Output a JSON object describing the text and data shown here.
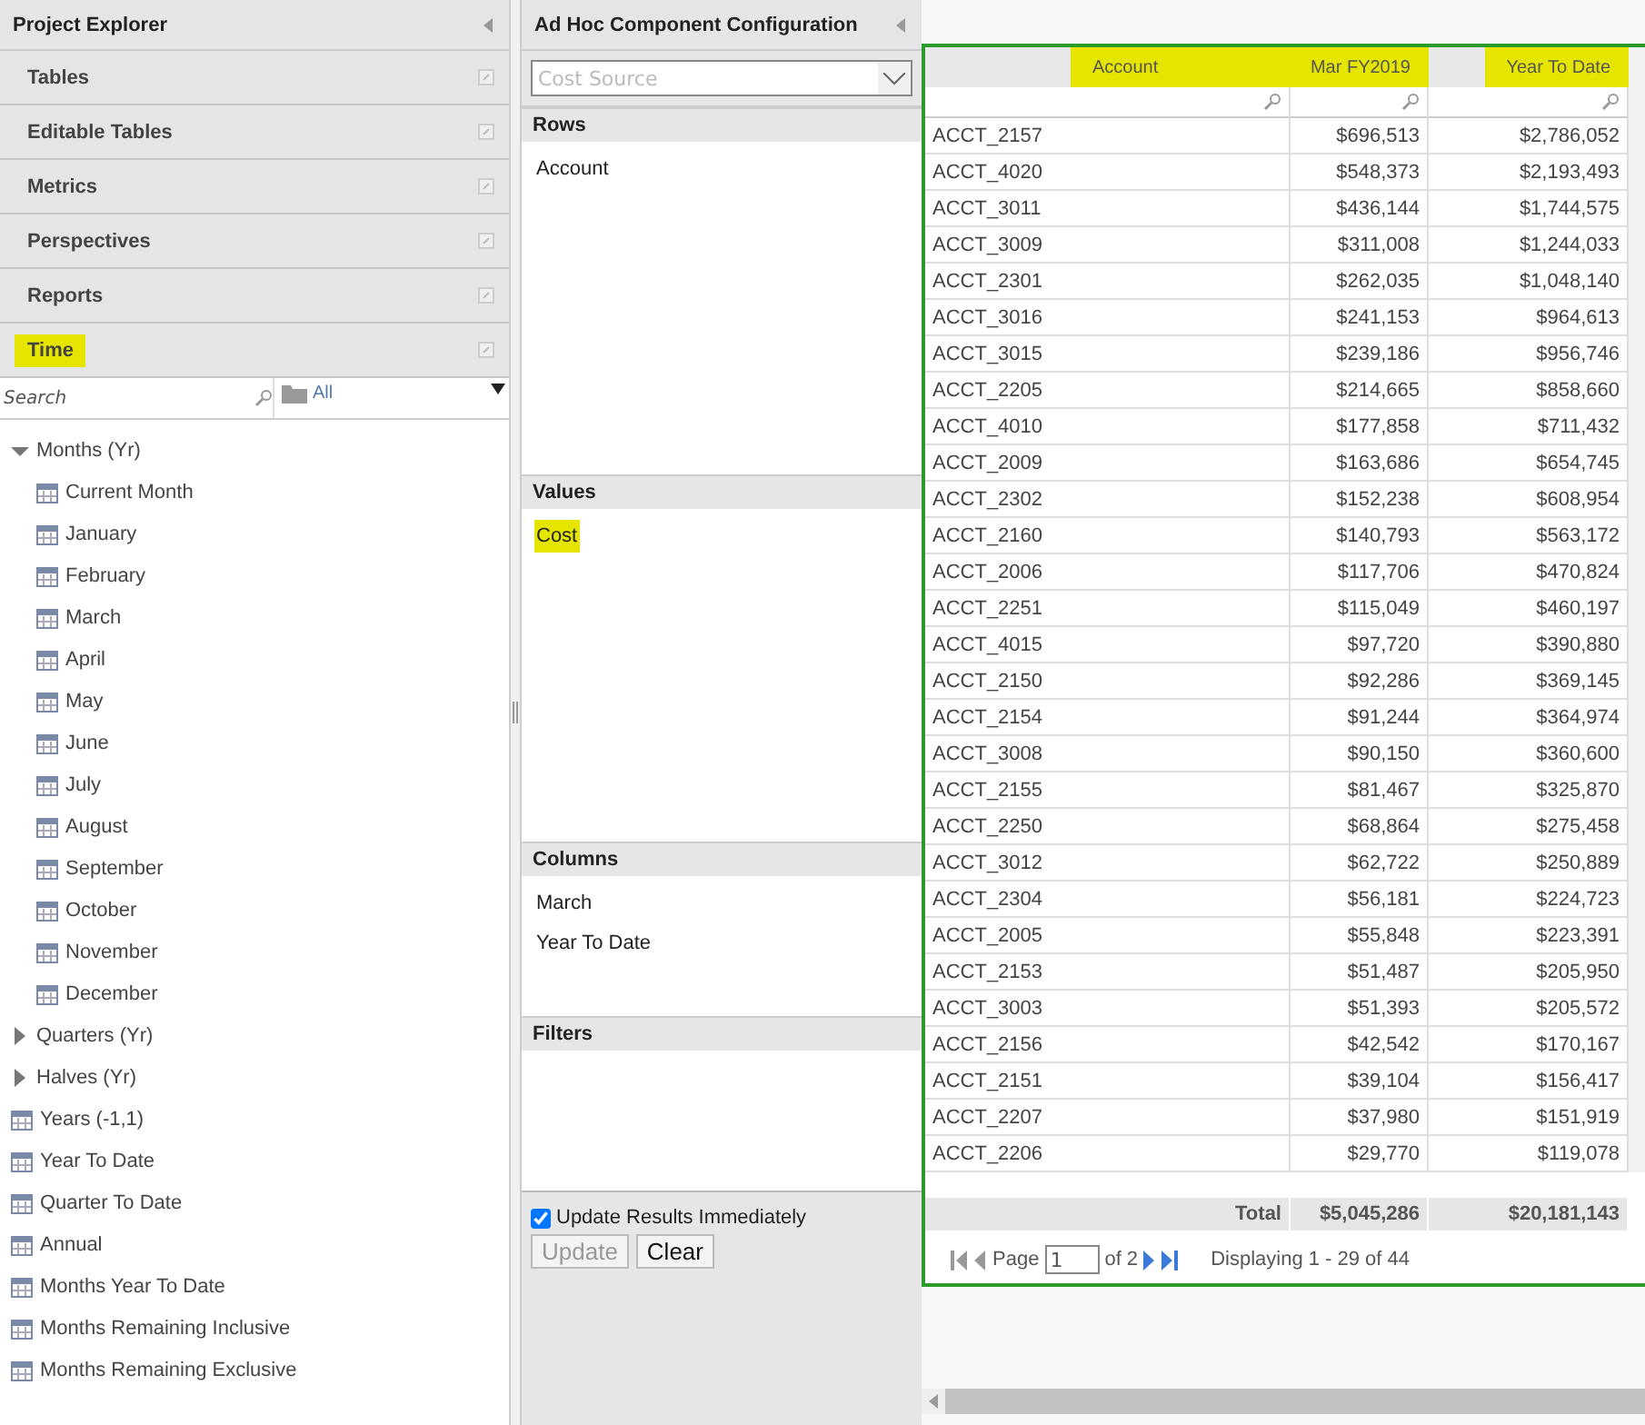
{
  "explorer": {
    "title": "Project Explorer",
    "sections": [
      {
        "label": "Tables",
        "highlighted": false
      },
      {
        "label": "Editable Tables",
        "highlighted": false
      },
      {
        "label": "Metrics",
        "highlighted": false
      },
      {
        "label": "Perspectives",
        "highlighted": false
      },
      {
        "label": "Reports",
        "highlighted": false
      },
      {
        "label": "Time",
        "highlighted": true
      }
    ],
    "search": {
      "placeholder": "Search"
    },
    "folder_filter": "All",
    "tree": [
      {
        "label": "Months (Yr)",
        "kind": "group",
        "expanded": true,
        "children": [
          {
            "label": "Current Month"
          },
          {
            "label": "January"
          },
          {
            "label": "February"
          },
          {
            "label": "March"
          },
          {
            "label": "April"
          },
          {
            "label": "May"
          },
          {
            "label": "June"
          },
          {
            "label": "July"
          },
          {
            "label": "August"
          },
          {
            "label": "September"
          },
          {
            "label": "October"
          },
          {
            "label": "November"
          },
          {
            "label": "December"
          }
        ]
      },
      {
        "label": "Quarters (Yr)",
        "kind": "group",
        "expanded": false
      },
      {
        "label": "Halves (Yr)",
        "kind": "group",
        "expanded": false
      },
      {
        "label": "Years (-1,1)"
      },
      {
        "label": "Year To Date"
      },
      {
        "label": "Quarter To Date"
      },
      {
        "label": "Annual"
      },
      {
        "label": "Months Year To Date"
      },
      {
        "label": "Months Remaining Inclusive"
      },
      {
        "label": "Months Remaining Exclusive"
      }
    ]
  },
  "config": {
    "title": "Ad Hoc Component Configuration",
    "source": {
      "placeholder": "Cost Source"
    },
    "zones": [
      {
        "title": "Rows",
        "items": [
          {
            "label": "Account",
            "highlighted": false
          }
        ]
      },
      {
        "title": "Values",
        "items": [
          {
            "label": "Cost",
            "highlighted": true
          }
        ]
      },
      {
        "title": "Columns",
        "items": [
          {
            "label": "March",
            "highlighted": false
          },
          {
            "label": "Year To Date",
            "highlighted": false
          }
        ]
      },
      {
        "title": "Filters"
      }
    ],
    "update_immediately": {
      "label": "Update Results Immediately",
      "checked": true
    },
    "buttons": [
      {
        "label": "Update",
        "disabled": true
      },
      {
        "label": "Clear",
        "disabled": false
      }
    ]
  },
  "table": {
    "columns": [
      {
        "label": "Account",
        "highlighted": true
      },
      {
        "label": "Mar FY2019",
        "highlighted": true
      },
      {
        "label": "Year To Date",
        "highlighted": true
      }
    ],
    "rows": [
      [
        "ACCT_2157",
        "$696,513",
        "$2,786,052"
      ],
      [
        "ACCT_4020",
        "$548,373",
        "$2,193,493"
      ],
      [
        "ACCT_3011",
        "$436,144",
        "$1,744,575"
      ],
      [
        "ACCT_3009",
        "$311,008",
        "$1,244,033"
      ],
      [
        "ACCT_2301",
        "$262,035",
        "$1,048,140"
      ],
      [
        "ACCT_3016",
        "$241,153",
        "$964,613"
      ],
      [
        "ACCT_3015",
        "$239,186",
        "$956,746"
      ],
      [
        "ACCT_2205",
        "$214,665",
        "$858,660"
      ],
      [
        "ACCT_4010",
        "$177,858",
        "$711,432"
      ],
      [
        "ACCT_2009",
        "$163,686",
        "$654,745"
      ],
      [
        "ACCT_2302",
        "$152,238",
        "$608,954"
      ],
      [
        "ACCT_2160",
        "$140,793",
        "$563,172"
      ],
      [
        "ACCT_2006",
        "$117,706",
        "$470,824"
      ],
      [
        "ACCT_2251",
        "$115,049",
        "$460,197"
      ],
      [
        "ACCT_4015",
        "$97,720",
        "$390,880"
      ],
      [
        "ACCT_2150",
        "$92,286",
        "$369,145"
      ],
      [
        "ACCT_2154",
        "$91,244",
        "$364,974"
      ],
      [
        "ACCT_3008",
        "$90,150",
        "$360,600"
      ],
      [
        "ACCT_2155",
        "$81,467",
        "$325,870"
      ],
      [
        "ACCT_2250",
        "$68,864",
        "$275,458"
      ],
      [
        "ACCT_3012",
        "$62,722",
        "$250,889"
      ],
      [
        "ACCT_2304",
        "$56,181",
        "$224,723"
      ],
      [
        "ACCT_2005",
        "$55,848",
        "$223,391"
      ],
      [
        "ACCT_2153",
        "$51,487",
        "$205,950"
      ],
      [
        "ACCT_3003",
        "$51,393",
        "$205,572"
      ],
      [
        "ACCT_2156",
        "$42,542",
        "$170,167"
      ],
      [
        "ACCT_2151",
        "$39,104",
        "$156,417"
      ],
      [
        "ACCT_2207",
        "$37,980",
        "$151,919"
      ],
      [
        "ACCT_2206",
        "$29,770",
        "$119,078"
      ]
    ],
    "total": [
      "Total",
      "$5,045,286",
      "$20,181,143"
    ],
    "pager": {
      "page_label": "Page",
      "page": "1",
      "of": "of 2",
      "display": "Displaying 1 - 29 of 44"
    }
  }
}
